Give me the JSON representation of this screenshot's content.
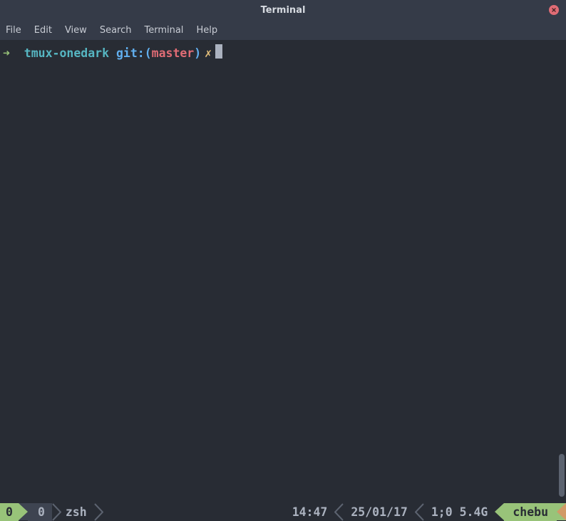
{
  "window": {
    "title": "Terminal"
  },
  "menu": {
    "items": [
      "File",
      "Edit",
      "View",
      "Search",
      "Terminal",
      "Help"
    ]
  },
  "prompt": {
    "arrow": "➜",
    "dir": "tmux-onedark",
    "git_label": "git:",
    "branch": "master",
    "dirty": "✗"
  },
  "tmux": {
    "session": "0",
    "window_index": "0",
    "window_name": "zsh",
    "time": "14:47",
    "date": "25/01/17",
    "load": "1;0 5.4G",
    "host": "chebu"
  },
  "colors": {
    "bg": "#282c34",
    "green": "#98c379",
    "cyan": "#56b6c2",
    "blue": "#61afef",
    "red": "#e06c75",
    "yellow": "#e5c07b",
    "grey": "#3e4451",
    "fg": "#abb2bf"
  }
}
